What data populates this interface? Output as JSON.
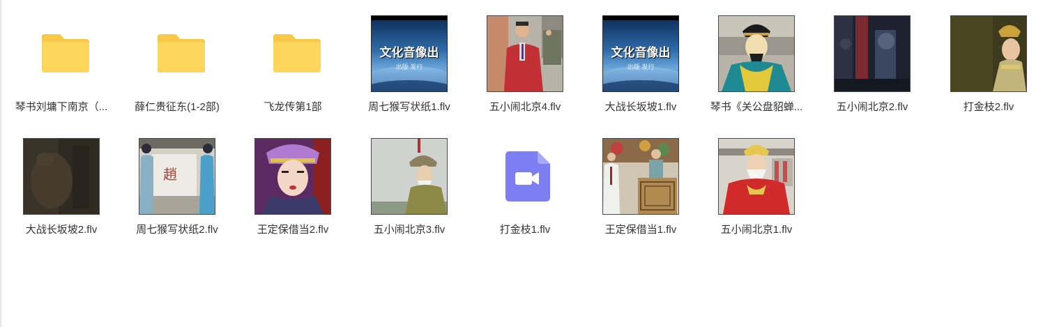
{
  "items": [
    {
      "name": "琴书刘墉下南京（...",
      "type": "folder"
    },
    {
      "name": "薛仁贵征东(1-2部)",
      "type": "folder"
    },
    {
      "name": "飞龙传第1部",
      "type": "folder"
    },
    {
      "name": "周七猴写状纸1.flv",
      "type": "video-thumbnail",
      "overlay_text": "文化音像出",
      "overlay_sub": "出版 发行"
    },
    {
      "name": "五小闹北京4.flv",
      "type": "video-thumbnail"
    },
    {
      "name": "大战长坂坡1.flv",
      "type": "video-thumbnail",
      "overlay_text": "文化音像出",
      "overlay_sub": "出版 发行"
    },
    {
      "name": "琴书《关公盘貂蝉...",
      "type": "video-thumbnail"
    },
    {
      "name": "五小闹北京2.flv",
      "type": "video-thumbnail"
    },
    {
      "name": "打金枝2.flv",
      "type": "video-thumbnail"
    },
    {
      "name": "大战长坂坡2.flv",
      "type": "video-thumbnail"
    },
    {
      "name": "周七猴写状纸2.flv",
      "type": "video-thumbnail"
    },
    {
      "name": "王定保借当2.flv",
      "type": "video-thumbnail"
    },
    {
      "name": "五小闹北京3.flv",
      "type": "video-thumbnail"
    },
    {
      "name": "打金枝1.flv",
      "type": "video-file-icon"
    },
    {
      "name": "王定保借当1.flv",
      "type": "video-thumbnail"
    },
    {
      "name": "五小闹北京1.flv",
      "type": "video-thumbnail"
    }
  ],
  "icons": {
    "folder": "folder-icon",
    "video_file": "video-file-icon",
    "thumbnail": "video-thumbnail"
  },
  "colors": {
    "folder_body": "#ffd65c",
    "folder_tab": "#f9c84a",
    "video_icon": "#7c7ef2",
    "label_text": "#333333"
  }
}
